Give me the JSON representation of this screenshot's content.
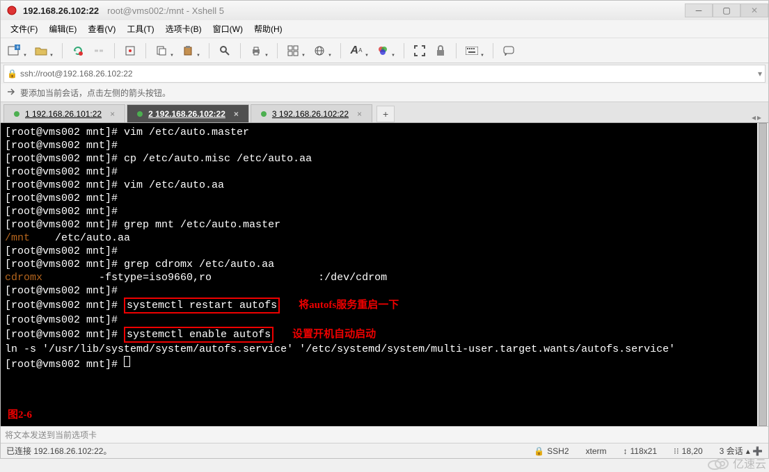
{
  "title": {
    "ip": "192.168.26.102:22",
    "subtitle": "root@vms002:/mnt - Xshell 5"
  },
  "menu": {
    "file": "文件(F)",
    "edit": "编辑(E)",
    "view": "查看(V)",
    "tools": "工具(T)",
    "tabs": "选项卡(B)",
    "window": "窗口(W)",
    "help": "帮助(H)"
  },
  "address": "ssh://root@192.168.26.102:22",
  "hint": "要添加当前会话，点击左侧的箭头按钮。",
  "tabs": {
    "t1": "1 192.168.26.101:22",
    "t2": "2 192.168.26.102:22",
    "t3": "3 192.168.26.102:22"
  },
  "term": {
    "p_prefix": "[root@vms002 mnt]# ",
    "lines": {
      "l1": "vim /etc/auto.master",
      "l2": "",
      "l3": "cp /etc/auto.misc /etc/auto.aa",
      "l4": "",
      "l5": "vim /etc/auto.aa",
      "l6": "",
      "l7": "",
      "l8": "grep mnt /etc/auto.master",
      "l9a": "/mnt",
      "l9b": "    /etc/auto.aa",
      "l10": "",
      "l11": "grep cdromx /etc/auto.aa",
      "l12a": "cdromx",
      "l12b": "         -fstype=iso9660,ro                 :/dev/cdrom",
      "l13": "",
      "l14": "systemctl restart autofs",
      "l14a": "将autofs服务重启一下",
      "l15": "",
      "l16": "systemctl enable autofs",
      "l16a": "设置开机自动启动",
      "l17": "ln -s '/usr/lib/systemd/system/autofs.service' '/etc/systemd/system/multi-user.target.wants/autofs.service'",
      "fig": "图2-6"
    }
  },
  "inputbar": "将文本发送到当前选项卡",
  "status": {
    "conn": "已连接 192.168.26.102:22。",
    "proto": "SSH2",
    "termtype": "xterm",
    "size": "118x21",
    "cursor": "18,20",
    "sessions": "3 会话"
  },
  "watermark": "亿速云"
}
